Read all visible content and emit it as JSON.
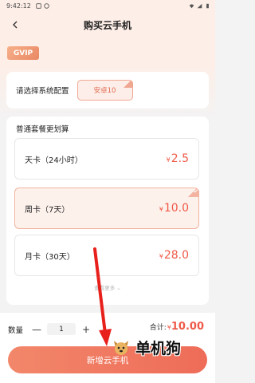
{
  "status_bar": {
    "time": "9:42:12"
  },
  "header": {
    "title": "购买云手机"
  },
  "badge": {
    "label": "GVIP"
  },
  "config": {
    "label": "请选择系统配置",
    "selected": "安卓10"
  },
  "plans_section": {
    "title": "普通套餐更划算",
    "items": [
      {
        "name": "天卡（24小时）",
        "currency": "¥",
        "price": "2.5",
        "selected": false
      },
      {
        "name": "周卡（7天）",
        "currency": "¥",
        "price": "10.0",
        "selected": true
      },
      {
        "name": "月卡（30天）",
        "currency": "¥",
        "price": "28.0",
        "selected": false
      }
    ],
    "view_more": "查看更多"
  },
  "quantity": {
    "label": "数量",
    "minus": "—",
    "value": "1",
    "plus": "+"
  },
  "total": {
    "label": "合计:",
    "currency": "¥",
    "amount": "10.00"
  },
  "primary_button": {
    "label": "新增云手机"
  },
  "watermark": {
    "text": "单机狗"
  },
  "colors": {
    "accent": "#ef5a48",
    "button": "#ee6c58",
    "chip_bg": "#fdeee9"
  }
}
